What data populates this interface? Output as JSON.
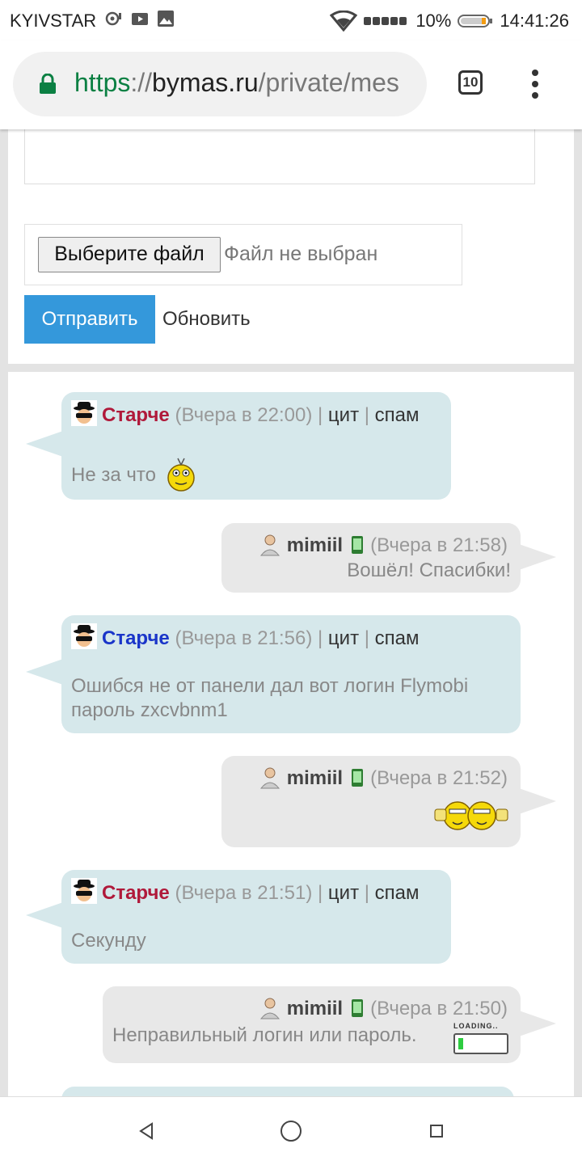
{
  "status_bar": {
    "carrier": "KYIVSTAR",
    "battery": "10%",
    "time": "14:41:26"
  },
  "browser": {
    "url_scheme": "https",
    "url_sep": "://",
    "url_host": "bymas.ru",
    "url_path": "/private/mes",
    "tab_count": "10"
  },
  "form": {
    "choose_file_label": "Выберите файл",
    "file_status": "Файл не выбран",
    "send_label": "Отправить",
    "refresh_label": "Обновить"
  },
  "messages": [
    {
      "side": "left",
      "author": "Старче",
      "time": "(Вчера в 22:00)",
      "quote": "цит",
      "spam": "спам",
      "text": "Не за что"
    },
    {
      "side": "right",
      "author": "mimiil",
      "time": "(Вчера в 21:58)",
      "text": "Вошёл! Спасибки!"
    },
    {
      "side": "left",
      "author": "Старче",
      "time": "(Вчера в 21:56)",
      "quote": "цит",
      "spam": "спам",
      "text_line1": "Ошибся не от панели дал вот логин Flymobi",
      "text_line2": "пароль zxcvbnm1"
    },
    {
      "side": "right",
      "author": "mimiil",
      "time": "(Вчера в 21:52)",
      "text": ""
    },
    {
      "side": "left",
      "author": "Старче",
      "time": "(Вчера в 21:51)",
      "quote": "цит",
      "spam": "спам",
      "text": "Секунду"
    },
    {
      "side": "right",
      "author": "mimiil",
      "time": "(Вчера в 21:50)",
      "text": "Неправильный логин или пароль.",
      "loading_text": "LOADING.."
    }
  ],
  "separator": "|",
  "colors": {
    "accent": "#3498db",
    "bubble_left": "#d6e8eb",
    "bubble_right": "#e8e8e8",
    "url_green": "#0b8043"
  }
}
